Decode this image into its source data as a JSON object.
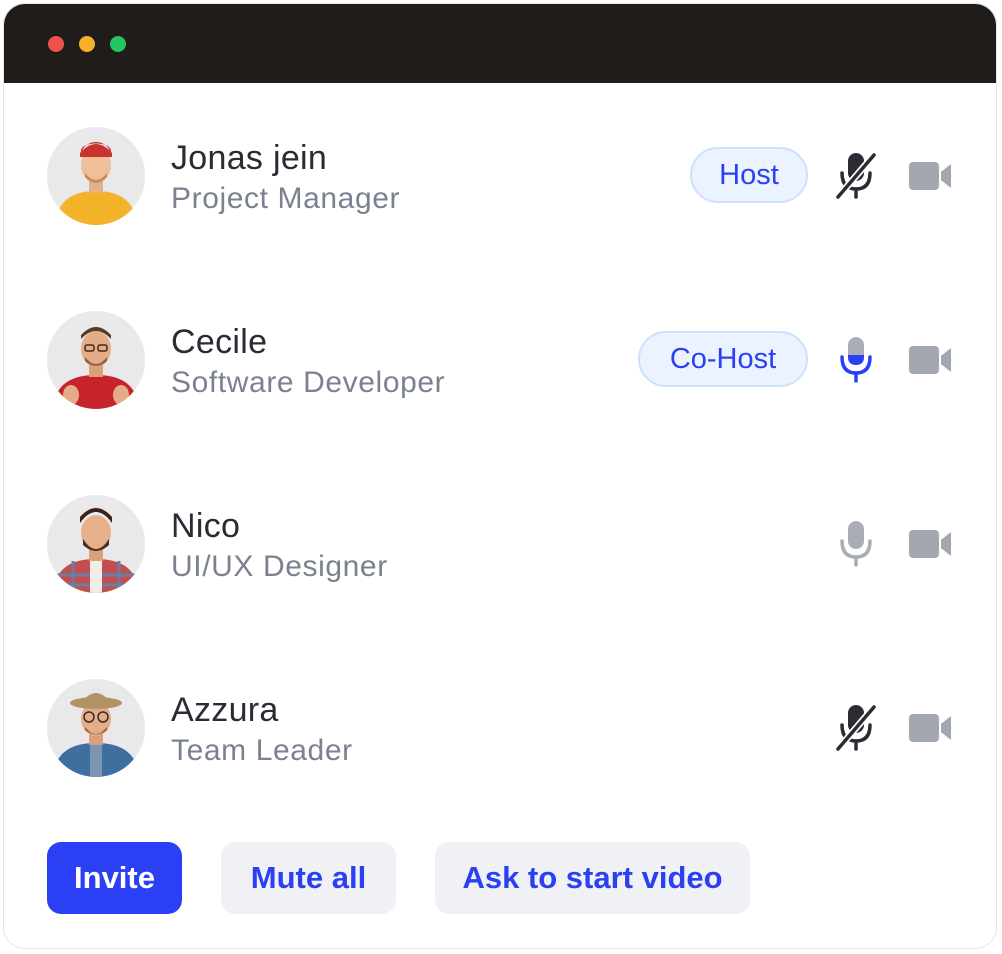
{
  "window": {
    "controls": [
      "close",
      "minimize",
      "maximize"
    ]
  },
  "participants": [
    {
      "name": "Jonas jein",
      "role": "Project Manager",
      "badge": "Host",
      "mic": "muted",
      "camera": "off"
    },
    {
      "name": "Cecile",
      "role": "Software Developer",
      "badge": "Co-Host",
      "mic": "active",
      "camera": "off"
    },
    {
      "name": "Nico",
      "role": "UI/UX Designer",
      "badge": "",
      "mic": "idle",
      "camera": "off"
    },
    {
      "name": "Azzura",
      "role": "Team Leader",
      "badge": "",
      "mic": "muted",
      "camera": "off"
    }
  ],
  "actions": {
    "invite": "Invite",
    "mute_all": "Mute all",
    "ask_video": "Ask to start video"
  },
  "icons": {
    "mic_muted": "mic-off-icon",
    "mic_active": "mic-icon",
    "camera": "video-camera-icon"
  },
  "colors": {
    "accent": "#2b40f5",
    "badge_bg": "#eaf3ff",
    "title_bar": "#201c19",
    "muted_icon": "#2a2b33",
    "idle_icon": "#a9adb6"
  }
}
